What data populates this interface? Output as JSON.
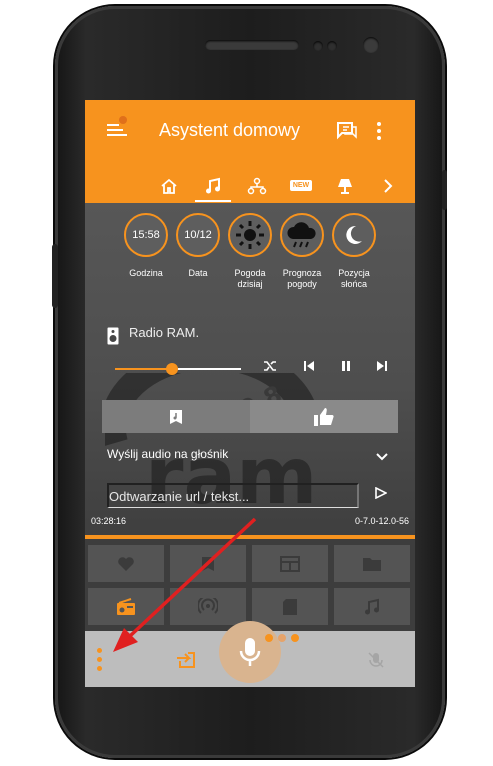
{
  "app": {
    "title": "Asystent domowy"
  },
  "tabs": [
    {
      "name": "home"
    },
    {
      "name": "music",
      "active": true
    },
    {
      "name": "network"
    },
    {
      "name": "new",
      "badge": "NEW"
    },
    {
      "name": "lamp"
    }
  ],
  "tiles": [
    {
      "value": "15:58",
      "label": "Godzina"
    },
    {
      "value": "10/12",
      "label": "Data"
    },
    {
      "icon": "sun-icon",
      "label": "Pogoda dzisiaj"
    },
    {
      "icon": "rain-cloud-icon",
      "label": "Prognoza pogody"
    },
    {
      "icon": "moon-icon",
      "label": "Pozycja słońca"
    }
  ],
  "player": {
    "station": "Radio RAM.",
    "progress": 0.45,
    "send_label": "Wyślij audio na głośnik",
    "url_placeholder": "Odtwarzanie url / tekst...",
    "time_elapsed": "03:28:16",
    "time_info": "0-7.0-12.0-56"
  },
  "logo_text": "ram 89.8",
  "colors": {
    "accent": "#f7931e",
    "bar_bg": "#bdbdbd"
  }
}
